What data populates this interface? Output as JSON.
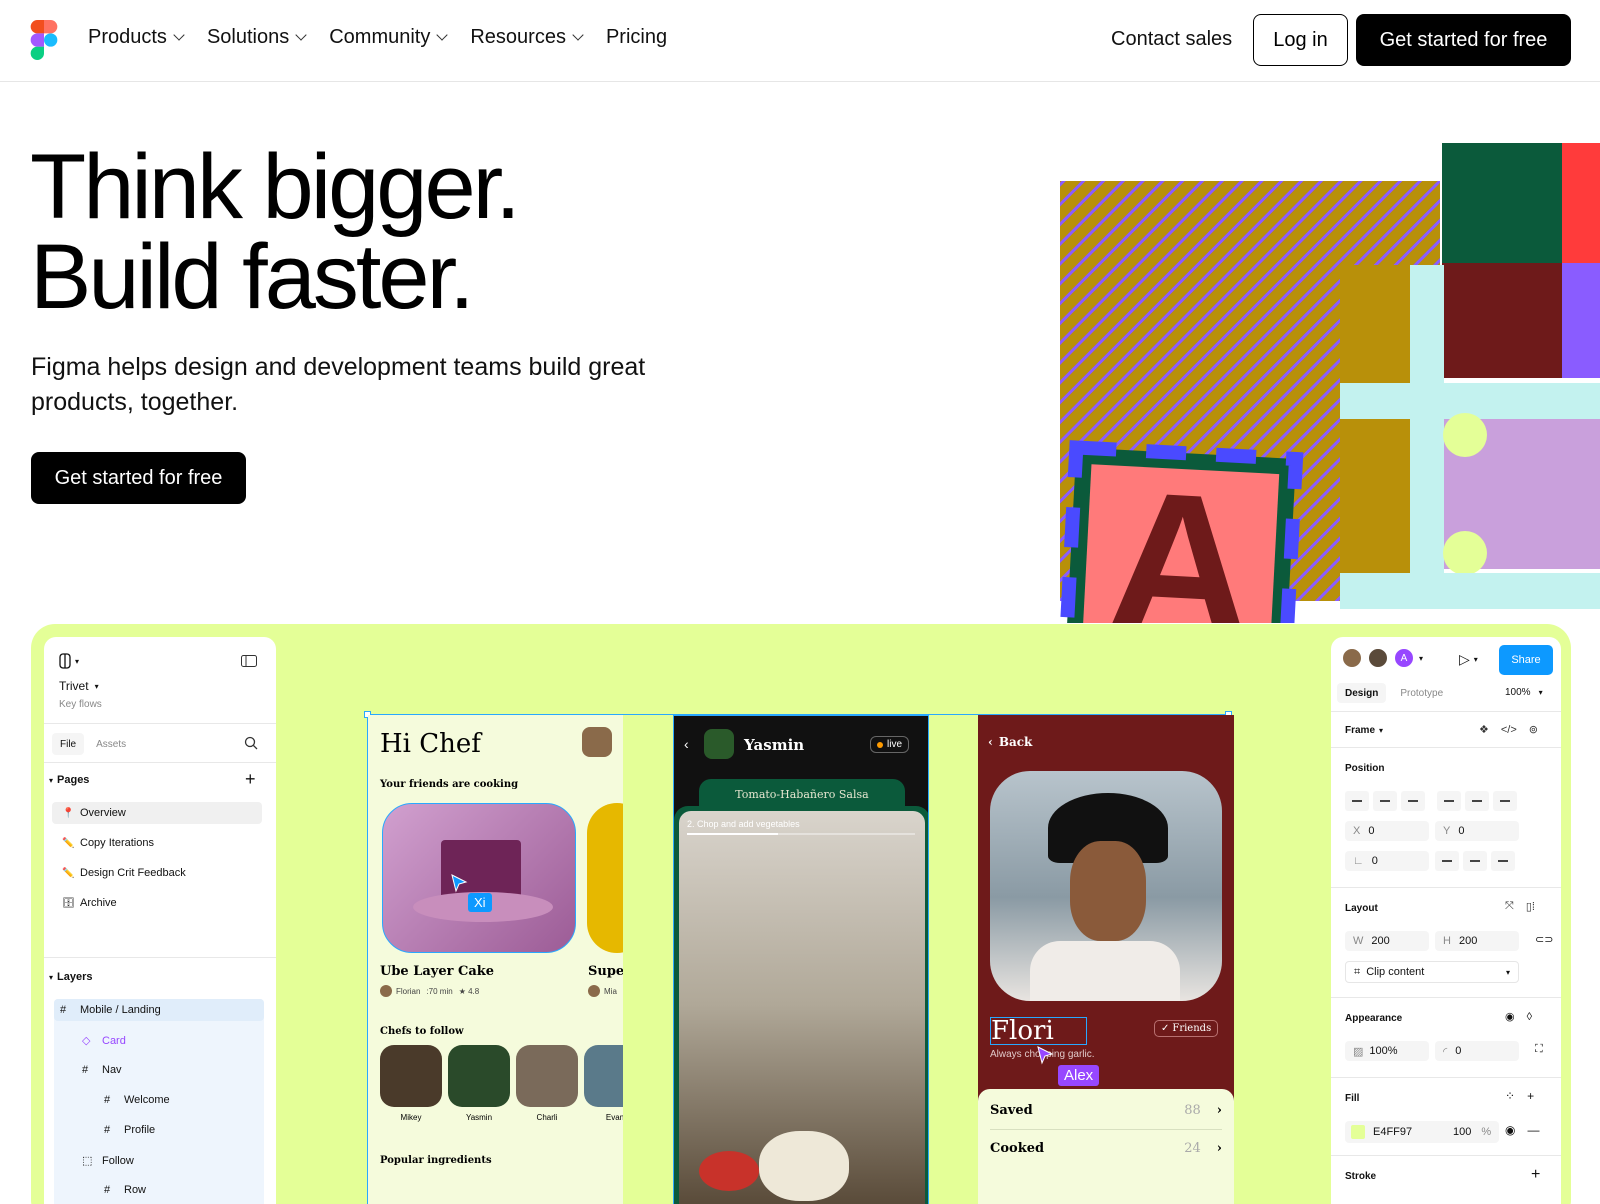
{
  "nav": {
    "links": [
      {
        "label": "Products",
        "has_menu": true
      },
      {
        "label": "Solutions",
        "has_menu": true
      },
      {
        "label": "Community",
        "has_menu": true
      },
      {
        "label": "Resources",
        "has_menu": true
      },
      {
        "label": "Pricing",
        "has_menu": false
      }
    ],
    "contact": "Contact sales",
    "login": "Log in",
    "cta": "Get started for free"
  },
  "hero": {
    "title_line1": "Think bigger.",
    "title_line2": "Build faster.",
    "subtitle": "Figma helps design and development teams build great products, together.",
    "cta": "Get started for free"
  },
  "art": {
    "letter": "A"
  },
  "editor": {
    "left": {
      "file_name": "Trivet",
      "file_sub": "Key flows",
      "tab_file": "File",
      "tab_assets": "Assets",
      "pages_label": "Pages",
      "pages": [
        "Overview",
        "Copy Iterations",
        "Design Crit Feedback",
        "Archive"
      ],
      "layers_label": "Layers",
      "layers": [
        {
          "label": "Mobile / Landing",
          "indent": 0
        },
        {
          "label": "Card",
          "indent": 1
        },
        {
          "label": "Nav",
          "indent": 1
        },
        {
          "label": "Welcome",
          "indent": 2
        },
        {
          "label": "Profile",
          "indent": 2
        },
        {
          "label": "Follow",
          "indent": 1
        },
        {
          "label": "Row",
          "indent": 2
        }
      ]
    },
    "frame1": {
      "greeting": "Hi Chef",
      "friends_label": "Your friends are cooking",
      "card1_title": "Ube Layer Cake",
      "card1_author": "Florian",
      "card1_time": ":70 min",
      "card1_rating": "★ 4.8",
      "card2_title": "Super",
      "card2_author": "Mia",
      "chefs_label": "Chefs to follow",
      "chefs": [
        "Mikey",
        "Yasmin",
        "Charli",
        "Evan"
      ],
      "popular_label": "Popular ingredients",
      "cursor_label": "Xi"
    },
    "frame2": {
      "name": "Yasmin",
      "live": "live",
      "recipe": "Tomato-Habañero Salsa",
      "step": "2.  Chop and add vegetables"
    },
    "frame3": {
      "back": "Back",
      "name": "Flori",
      "friends": "Friends",
      "tagline": "Always chopping garlic.",
      "cursor_label": "Alex",
      "stats": [
        {
          "label": "Saved",
          "value": "88"
        },
        {
          "label": "Cooked",
          "value": "24"
        }
      ]
    },
    "right": {
      "avatar_letter": "A",
      "share": "Share",
      "tab_design": "Design",
      "tab_prototype": "Prototype",
      "zoom": "100%",
      "frame_label": "Frame",
      "position_label": "Position",
      "x_label": "X",
      "x_value": "0",
      "y_label": "Y",
      "y_value": "0",
      "rotation_value": "0",
      "layout_label": "Layout",
      "w_label": "W",
      "w_value": "200",
      "h_label": "H",
      "h_value": "200",
      "clip": "Clip content",
      "appearance_label": "Appearance",
      "opacity": "100%",
      "radius": "0",
      "fill_label": "Fill",
      "fill_hex": "E4FF97",
      "fill_opacity": "100",
      "fill_unit": "%",
      "stroke_label": "Stroke"
    }
  },
  "colors": {
    "lime": "#e4ff97",
    "blue": "#0d99ff",
    "purple": "#9747ff"
  }
}
